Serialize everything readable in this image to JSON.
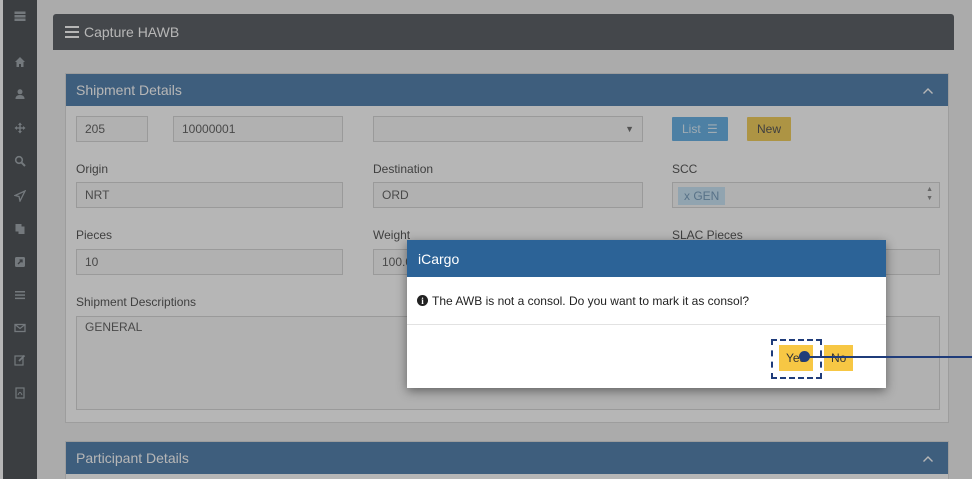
{
  "page": {
    "title": "Capture HAWB"
  },
  "sidebar": {
    "icons": [
      "menu-icon",
      "home-icon",
      "user-icon",
      "move-icon",
      "search-icon",
      "send-icon",
      "copy-icon",
      "external-icon",
      "list-icon",
      "mail-icon",
      "edit-icon",
      "pdf-icon"
    ]
  },
  "shipment": {
    "section_title": "Shipment Details",
    "awb_prefix": "205",
    "awb_number": "10000001",
    "select_value": "",
    "list_button": "List",
    "new_button": "New",
    "origin_label": "Origin",
    "origin_value": "NRT",
    "destination_label": "Destination",
    "destination_value": "ORD",
    "scc_label": "SCC",
    "scc_tag": "x GEN",
    "pieces_label": "Pieces",
    "pieces_value": "10",
    "weight_label": "Weight",
    "weight_value": "100.0",
    "slac_label": "SLAC Pieces",
    "descriptions_label": "Shipment Descriptions",
    "descriptions_value": "GENERAL"
  },
  "participants": {
    "section_title": "Participant Details"
  },
  "dialog": {
    "title": "iCargo",
    "message": "The AWB is not a consol. Do you want to mark it as consol?",
    "yes_label": "Yes",
    "no_label": "No"
  },
  "colors": {
    "panel_header": "#31689d",
    "dialog_header": "#2c6397",
    "yes_no_button": "#f7c744",
    "annotation": "#1f3c7a"
  }
}
